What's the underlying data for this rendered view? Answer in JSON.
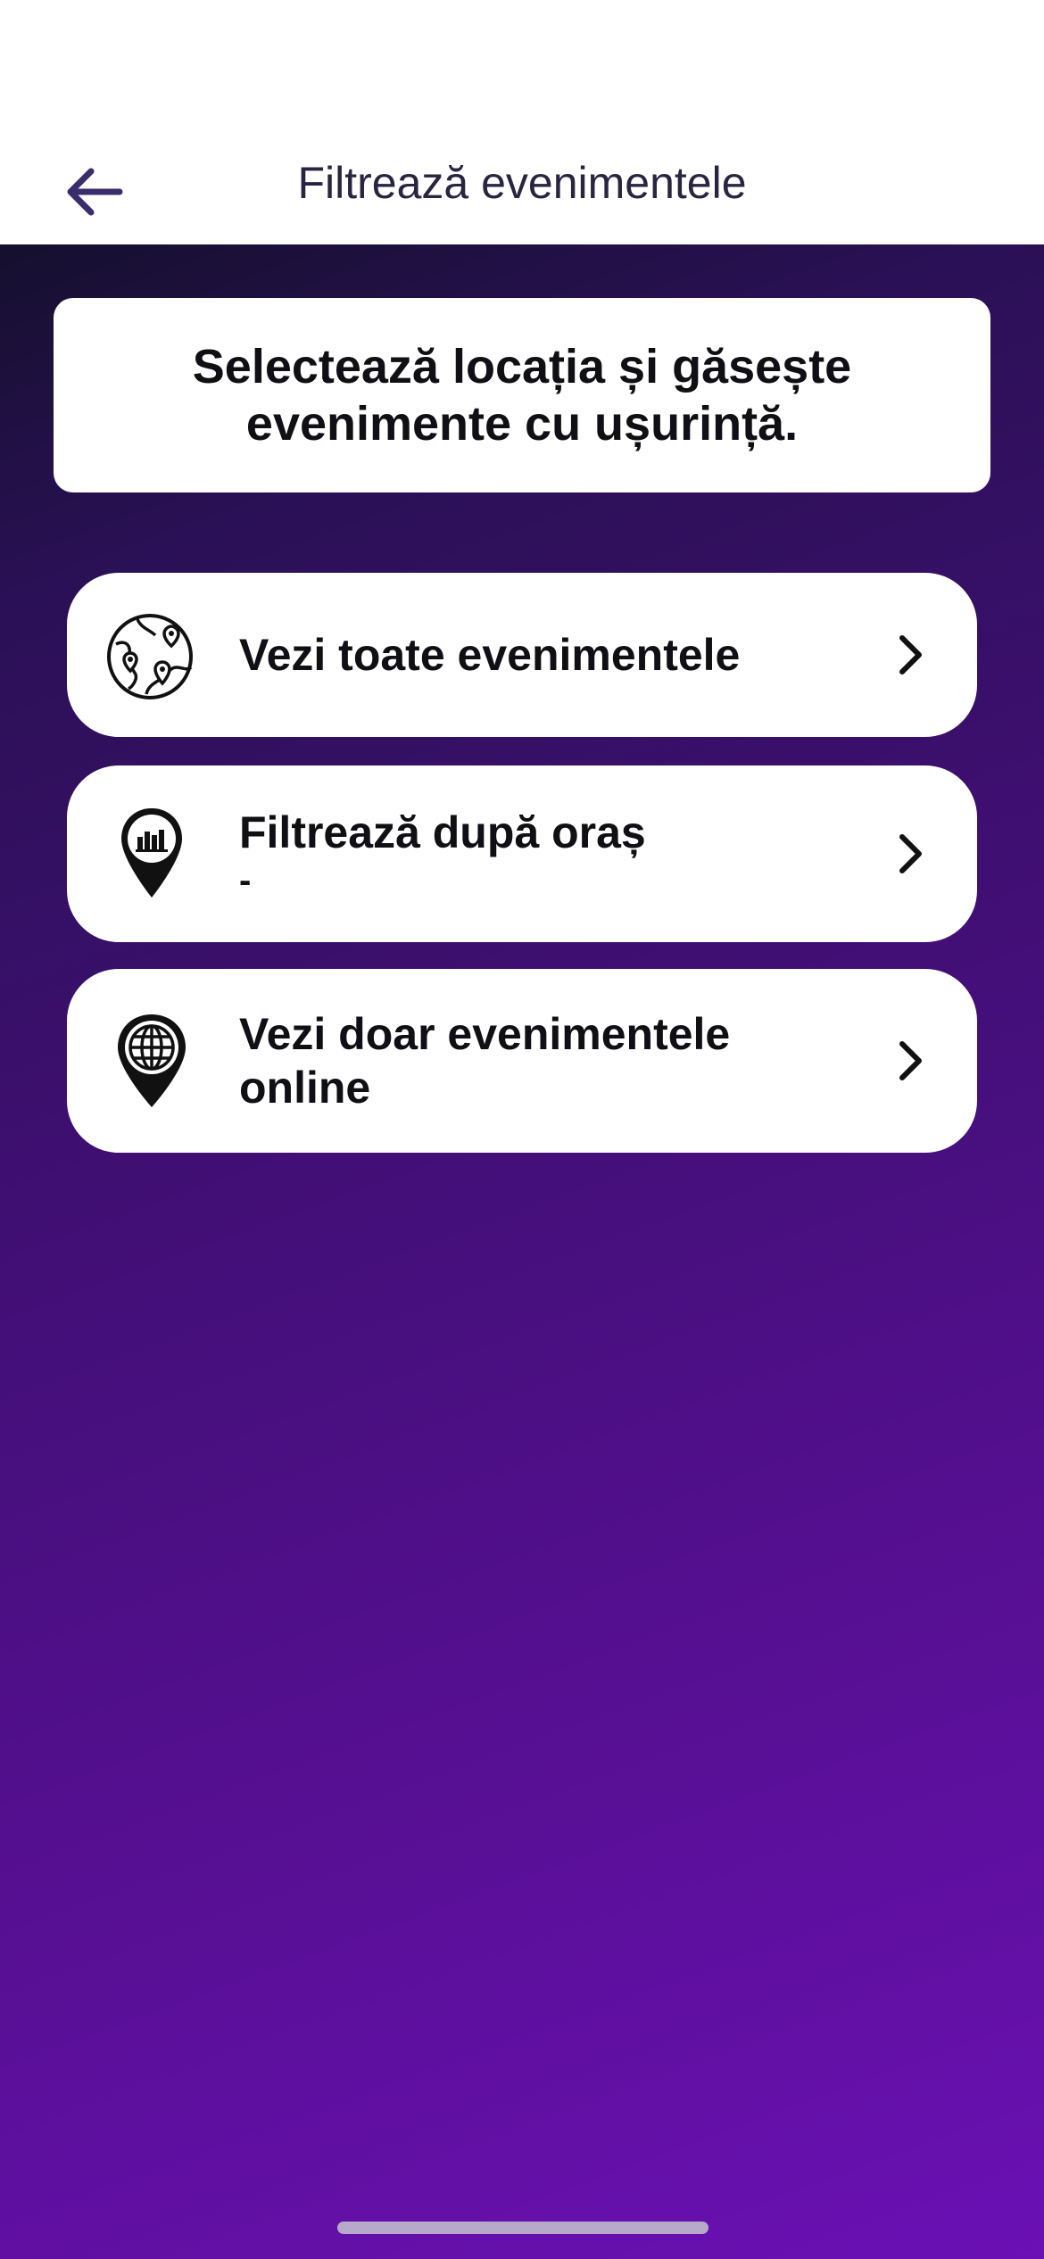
{
  "header": {
    "title": "Filtrează evenimentele",
    "back_icon": "arrow-left-icon"
  },
  "intro": {
    "text": "Selectează locația și găsește evenimente cu ușurință."
  },
  "options": [
    {
      "label": "Vezi toate evenimentele",
      "sublabel": "",
      "icon": "globe-pins-icon"
    },
    {
      "label": "Filtrează după oraș",
      "sublabel": "-",
      "icon": "city-pin-icon"
    },
    {
      "label": "Vezi doar evenimentele online",
      "sublabel": "",
      "icon": "globe-pin-icon"
    }
  ],
  "colors": {
    "accent": "#3a2d6b",
    "gradient_top": "#15102e",
    "gradient_bottom": "#6a10b4"
  }
}
